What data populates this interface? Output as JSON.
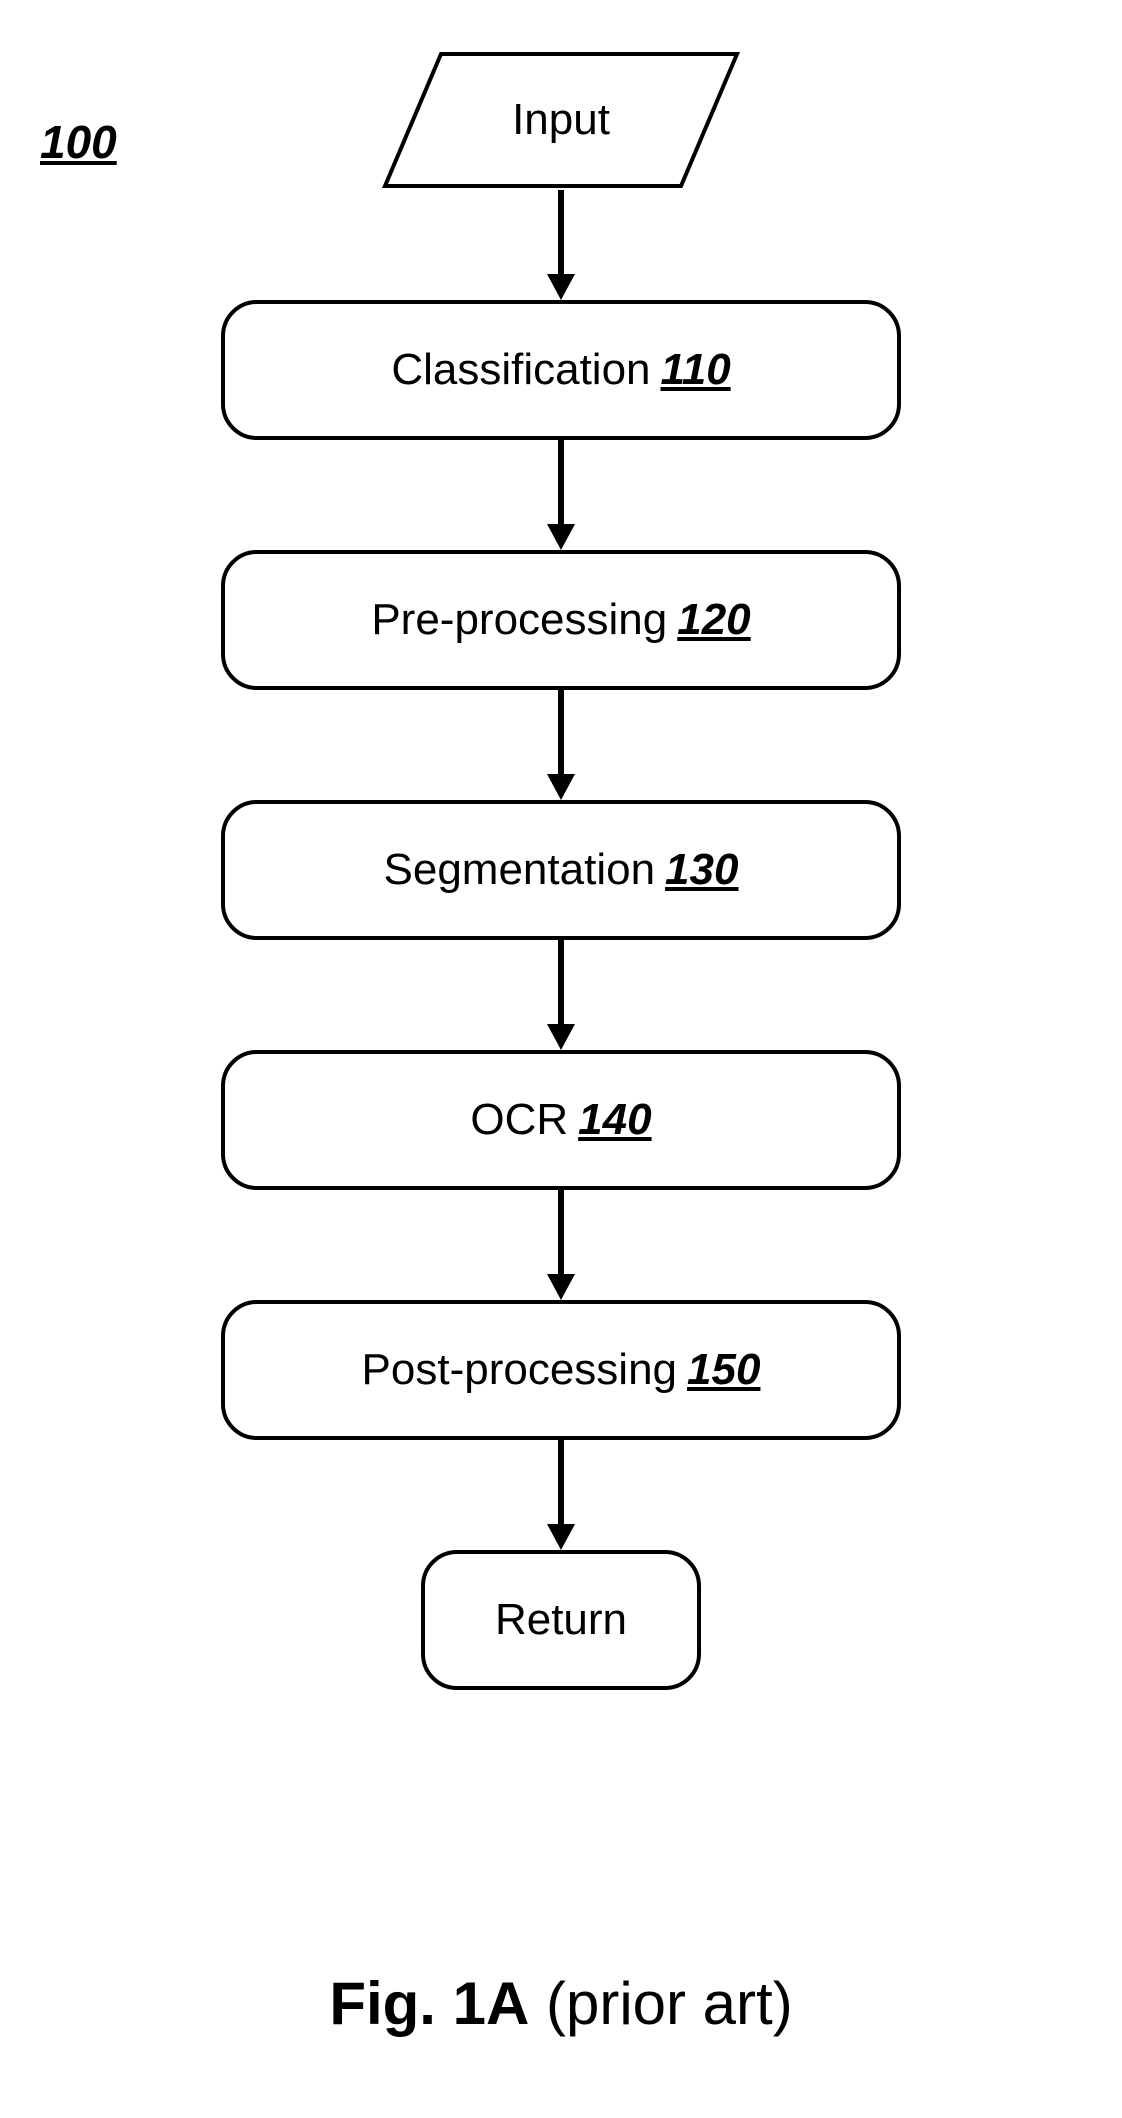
{
  "diagram_ref": "100",
  "input_node": {
    "label": "Input"
  },
  "steps": [
    {
      "label": "Classification",
      "ref": "110"
    },
    {
      "label": "Pre-processing",
      "ref": "120"
    },
    {
      "label": "Segmentation",
      "ref": "130"
    },
    {
      "label": "OCR",
      "ref": "140"
    },
    {
      "label": "Post-processing",
      "ref": "150"
    }
  ],
  "return_node": {
    "label": "Return"
  },
  "caption": {
    "fig": "Fig. 1A",
    "note": " (prior art)"
  }
}
